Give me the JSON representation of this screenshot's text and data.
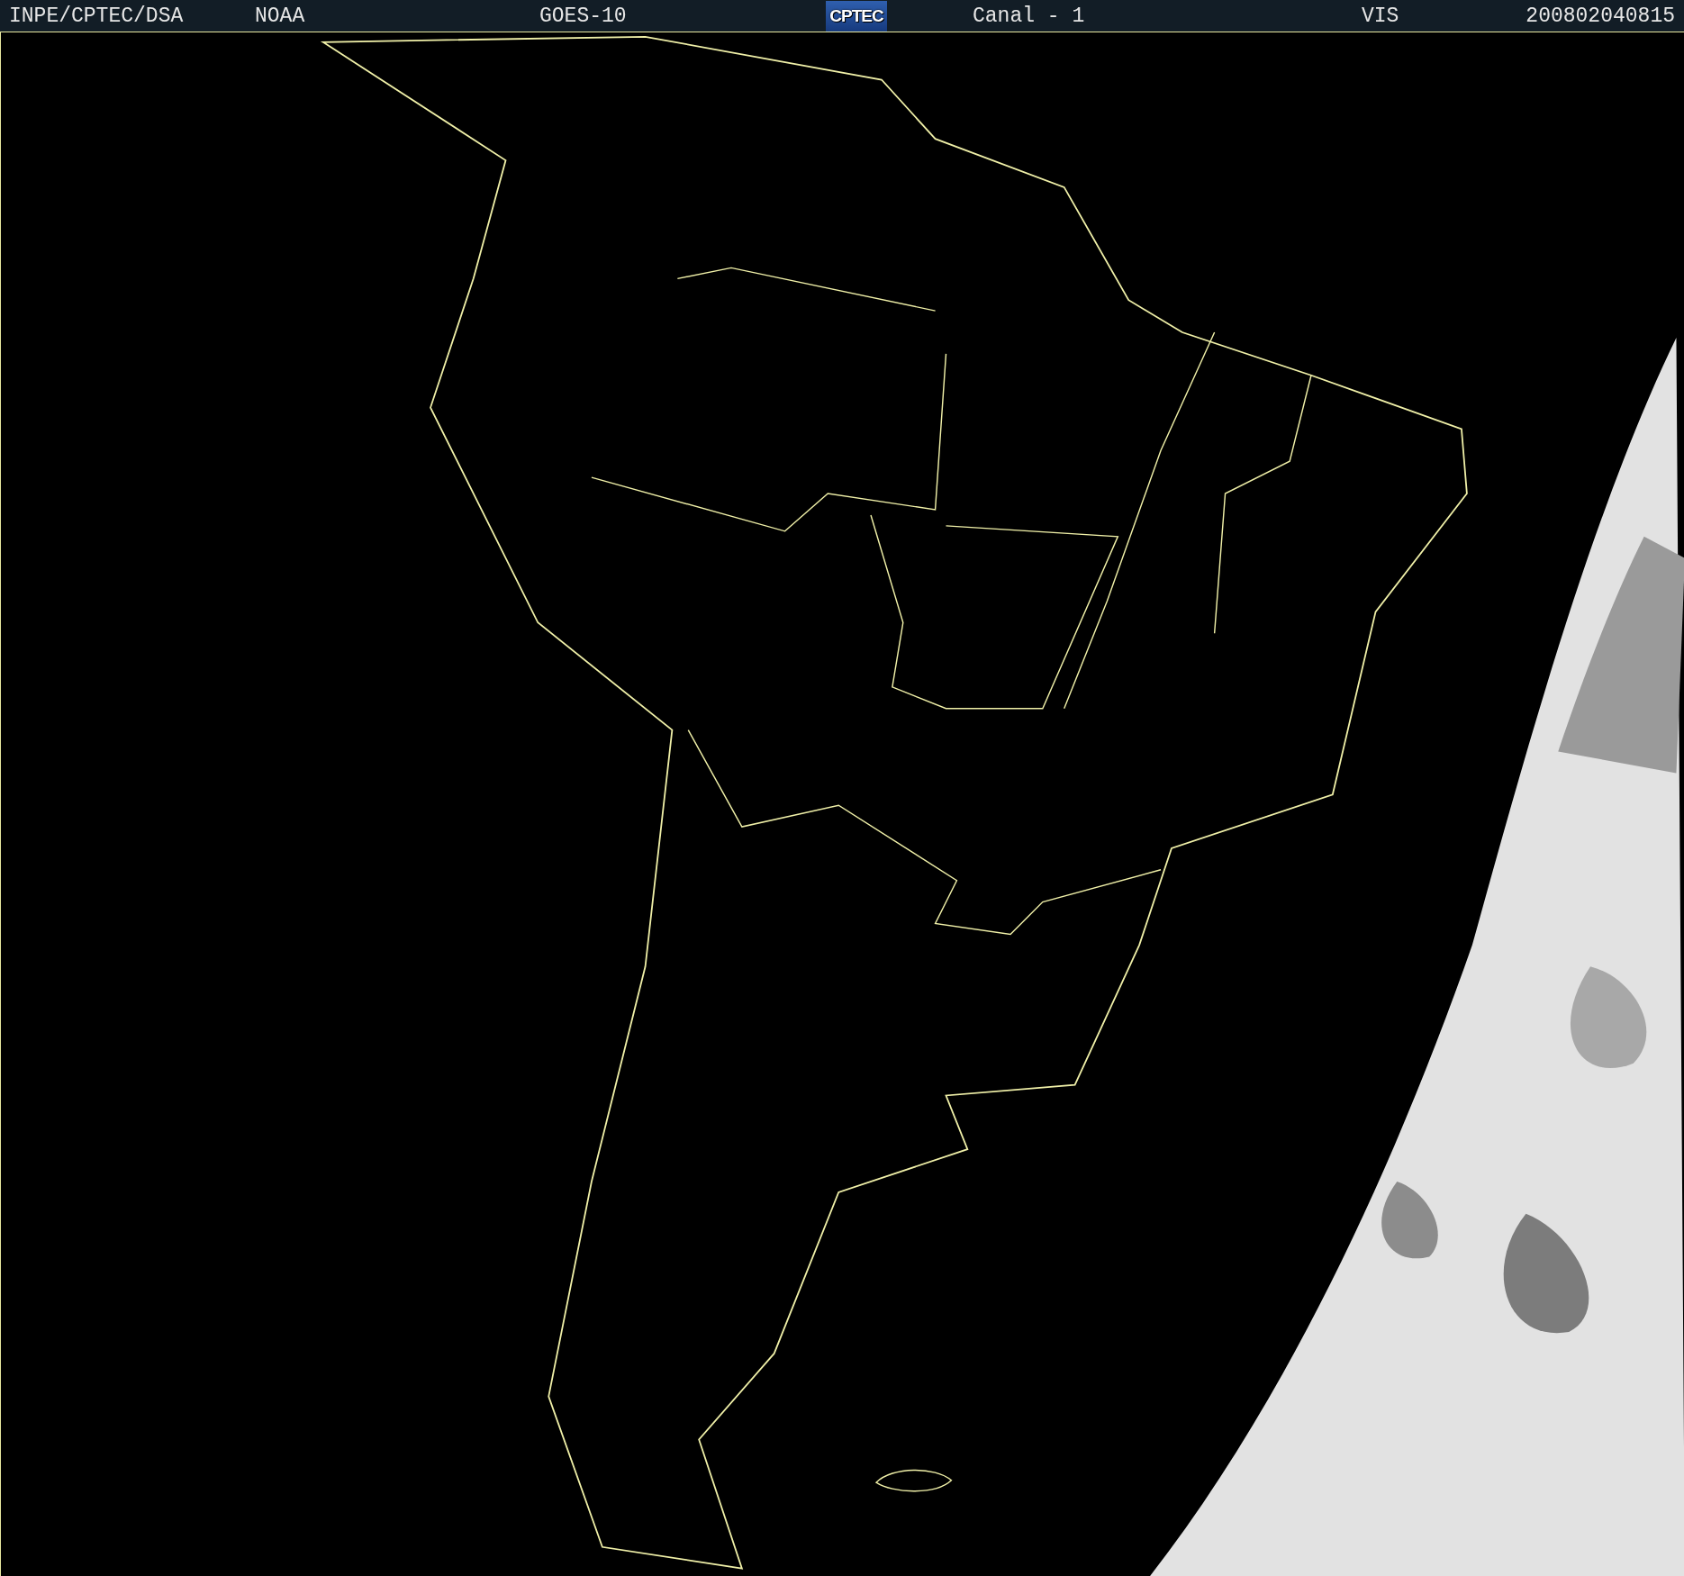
{
  "header": {
    "source": "INPE/CPTEC/DSA",
    "agency": "NOAA",
    "satellite": "GOES-10",
    "logo": "CPTEC",
    "channel": "Canal - 1",
    "band": "VIS",
    "timestamp": "200802040815"
  }
}
